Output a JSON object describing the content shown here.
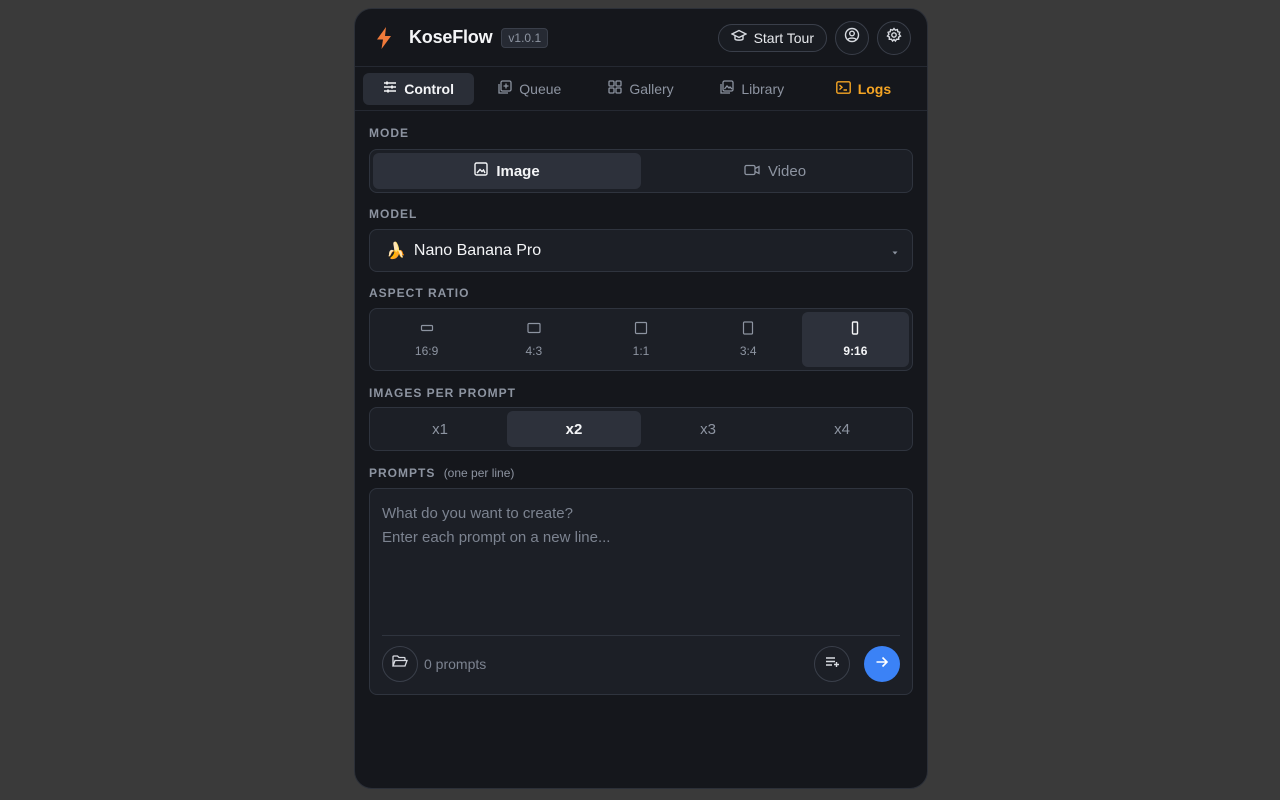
{
  "app": {
    "title": "KoseFlow",
    "version": "v1.0.1",
    "start_tour_label": "Start Tour",
    "accent_color": "#f5a524"
  },
  "tabs": [
    {
      "label": "Control",
      "icon": "sliders-icon",
      "active": true
    },
    {
      "label": "Queue",
      "icon": "queue-add-icon"
    },
    {
      "label": "Gallery",
      "icon": "grid-icon"
    },
    {
      "label": "Library",
      "icon": "library-icon"
    },
    {
      "label": "Logs",
      "icon": "terminal-icon",
      "highlight": true
    }
  ],
  "mode": {
    "label": "MODE",
    "options": [
      {
        "label": "Image",
        "icon": "image-icon",
        "active": true
      },
      {
        "label": "Video",
        "icon": "video-icon"
      }
    ]
  },
  "model": {
    "label": "MODEL",
    "selected_emoji": "🍌",
    "selected": "Nano Banana Pro"
  },
  "aspect_ratio": {
    "label": "ASPECT RATIO",
    "options": [
      "16:9",
      "4:3",
      "1:1",
      "3:4",
      "9:16"
    ],
    "selected": "9:16"
  },
  "images_per_prompt": {
    "label": "IMAGES PER PROMPT",
    "options": [
      "x1",
      "x2",
      "x3",
      "x4"
    ],
    "selected": "x2"
  },
  "prompts": {
    "label": "PROMPTS",
    "hint": "(one per line)",
    "placeholder": "What do you want to create?\nEnter each prompt on a new line...",
    "value": "",
    "count_text": "0 prompts",
    "send_color": "#3b82f6"
  }
}
